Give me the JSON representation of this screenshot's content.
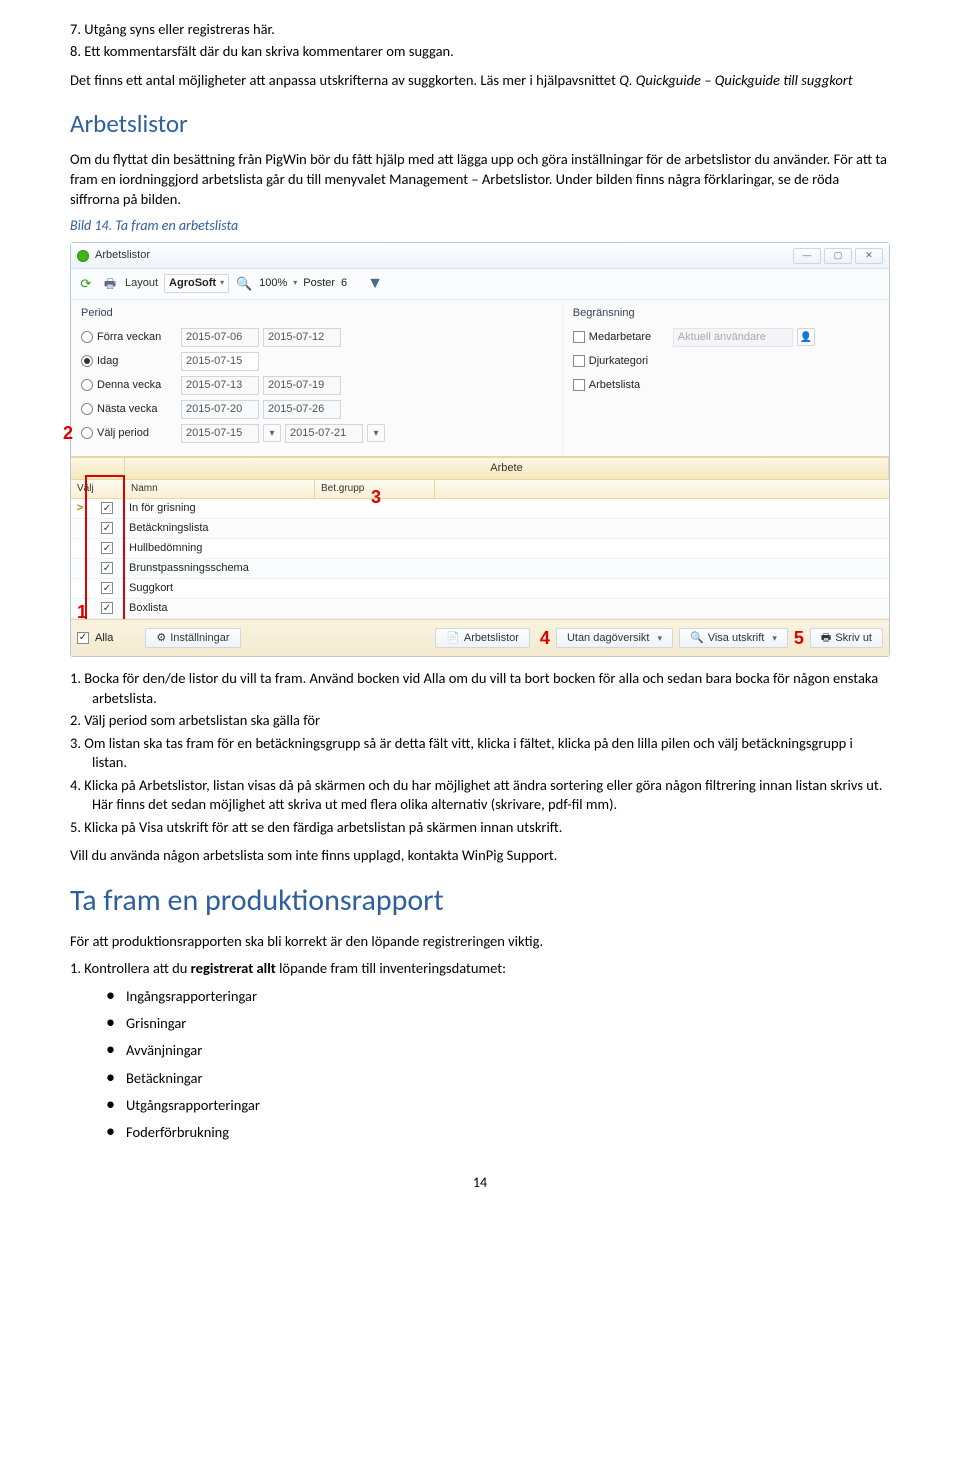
{
  "top_list": {
    "item7": "7.  Utgång syns eller registreras här.",
    "item8": "8.  Ett kommentarsfält där du kan skriva kommentarer om suggan."
  },
  "intro_para": {
    "plain1": "Det finns ett antal möjligheter att anpassa utskrifterna av suggkorten. Läs mer i hjälpavsnittet ",
    "link1": "Q. Quickguide – Quickguide till suggkort"
  },
  "heading_arbetsl": "Arbetslistor",
  "arbetsl_para": "Om du flyttat din besättning från PigWin bör du fått hjälp med att lägga upp och göra inställningar för de arbetslistor du använder. För att ta fram en iordninggjord arbetslista går du till menyvalet Management – Arbetslistor. Under bilden finns några förklaringar, se de röda siffrorna på bilden.",
  "caption": "Bild 14. Ta fram en arbetslista",
  "window": {
    "title": "Arbetslistor",
    "toolbar": {
      "layout_label": "Layout",
      "layout_value": "AgroSoft",
      "zoom": "100%",
      "poster_label": "Poster",
      "poster_value": "6"
    },
    "period": {
      "label": "Period",
      "rows": [
        {
          "radio": false,
          "label": "Förra veckan",
          "d1": "2015-07-06",
          "d2": "2015-07-12"
        },
        {
          "radio": true,
          "label": "Idag",
          "d1": "2015-07-15",
          "d2": ""
        },
        {
          "radio": false,
          "label": "Denna vecka",
          "d1": "2015-07-13",
          "d2": "2015-07-19"
        },
        {
          "radio": false,
          "label": "Nästa vecka",
          "d1": "2015-07-20",
          "d2": "2015-07-26"
        },
        {
          "radio": false,
          "label": "Välj period",
          "d1": "2015-07-15",
          "d2": "2015-07-21"
        }
      ]
    },
    "begr": {
      "label": "Begränsning",
      "rows": [
        {
          "label": "Medarbetare",
          "value": "Aktuell användare"
        },
        {
          "label": "Djurkategori"
        },
        {
          "label": "Arbetslista"
        }
      ]
    },
    "table": {
      "h_arbete": "Arbete",
      "h_valj": "Välj",
      "h_namn": "Namn",
      "h_bet": "Bet.grupp",
      "rows": [
        "In för grisning",
        "Betäckningslista",
        "Hullbedömning",
        "Brunstpassningsschema",
        "Suggkort",
        "Boxlista"
      ]
    },
    "bottom": {
      "alla": "Alla",
      "inst": "Inställningar",
      "arb": "Arbetslistor",
      "utan": "Utan dagöversikt",
      "visa": "Visa utskrift",
      "skriv": "Skriv ut"
    },
    "red": {
      "r1": "1",
      "r2": "2",
      "r3": "3",
      "r4": "4",
      "r5": "5"
    }
  },
  "below_list": {
    "i1a": "1.  Bocka för den/de listor du vill ta fram. Använd bocken vid Alla om du vill ta bort bocken för alla och sedan bara bocka för någon enstaka arbetslista.",
    "i2": "2.  Välj period som arbetslistan ska gälla för",
    "i3": "3.  Om listan ska tas fram för en betäckningsgrupp så är detta fält vitt, klicka i fältet, klicka på den lilla pilen och välj betäckningsgrupp i listan.",
    "i4": "4.  Klicka på Arbetslistor, listan visas då på skärmen och du har möjlighet att ändra sortering eller göra någon filtrering innan listan skrivs ut. Här finns det sedan möjlighet att skriva ut med flera olika alternativ (skrivare, pdf-fil mm).",
    "i5": "5.  Klicka på Visa utskrift för att se den färdiga arbetslistan på skärmen innan utskrift."
  },
  "support_line": "Vill du använda någon arbetslista som inte finns upplagd, kontakta WinPig Support.",
  "heading_prod": "Ta fram en produktionsrapport",
  "prod_intro": "För att produktionsrapporten ska bli korrekt är den löpande registreringen viktig.",
  "prod_step1_pre": "1.  Kontrollera att du ",
  "prod_step1_bold": "registrerat allt",
  "prod_step1_post": " löpande fram till inventeringsdatumet:",
  "bullets": [
    "Ingångsrapporteringar",
    "Grisningar",
    "Avvänjningar",
    "Betäckningar",
    "Utgångsrapporteringar",
    "Foderförbrukning"
  ],
  "page_num": "14"
}
